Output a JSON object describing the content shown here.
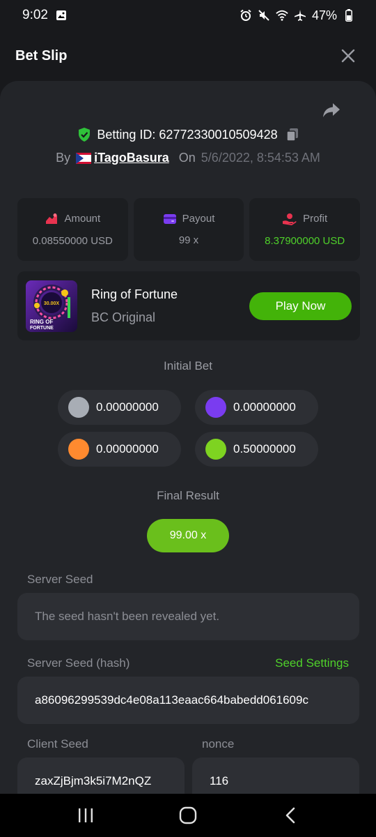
{
  "status_bar": {
    "time": "9:02",
    "battery": "47%",
    "icons": [
      "image-icon",
      "alarm-icon",
      "mute-icon",
      "wifi-icon",
      "airplane-icon",
      "battery-icon"
    ]
  },
  "header": {
    "title": "Bet Slip",
    "close_icon": "close-icon"
  },
  "bet": {
    "betting_id_label": "Betting ID: 62772330010509428",
    "by_label": "By",
    "username": "iTagoBasura",
    "on_label": "On",
    "date": "5/6/2022, 8:54:53 AM"
  },
  "stats": [
    {
      "label": "Amount",
      "value": "0.08550000 USD",
      "icon": "amount-icon",
      "icon_color": "#e8334f"
    },
    {
      "label": "Payout",
      "value": "99 x",
      "icon": "wallet-icon",
      "icon_color": "#7a3cf0"
    },
    {
      "label": "Profit",
      "value": "8.37900000 USD",
      "icon": "profit-icon",
      "icon_color": "#e8334f",
      "value_color": "#4fd12a"
    }
  ],
  "game": {
    "name": "Ring of Fortune",
    "provider": "BC Original",
    "thumb_multiplier": "30.00X",
    "thumb_title_1": "RING OF",
    "thumb_title_2": "FORTUNE",
    "play_label": "Play Now"
  },
  "initial_bet": {
    "title": "Initial Bet",
    "bets": [
      {
        "color": "#a8adb5",
        "value": "0.00000000"
      },
      {
        "color": "#7a3cf0",
        "value": "0.00000000"
      },
      {
        "color": "#ff8a2f",
        "value": "0.00000000"
      },
      {
        "color": "#7ed321",
        "value": "0.50000000"
      }
    ]
  },
  "final_result": {
    "title": "Final Result",
    "value": "99.00 x"
  },
  "seeds": {
    "server_seed_label": "Server Seed",
    "server_seed_value": "The seed hasn't been revealed yet.",
    "server_seed_hash_label": "Server Seed (hash)",
    "seed_settings_label": "Seed Settings",
    "server_seed_hash_value": "a86096299539dc4e08a113eaac664babedd061609c",
    "client_seed_label": "Client Seed",
    "client_seed_value": "zaxZjBjm3k5i7M2nQZ",
    "nonce_label": "nonce",
    "nonce_value": "116"
  },
  "colors": {
    "accent_green": "#43b309",
    "profit_green": "#4fd12a",
    "background": "#18191c",
    "sheet": "#232529"
  }
}
